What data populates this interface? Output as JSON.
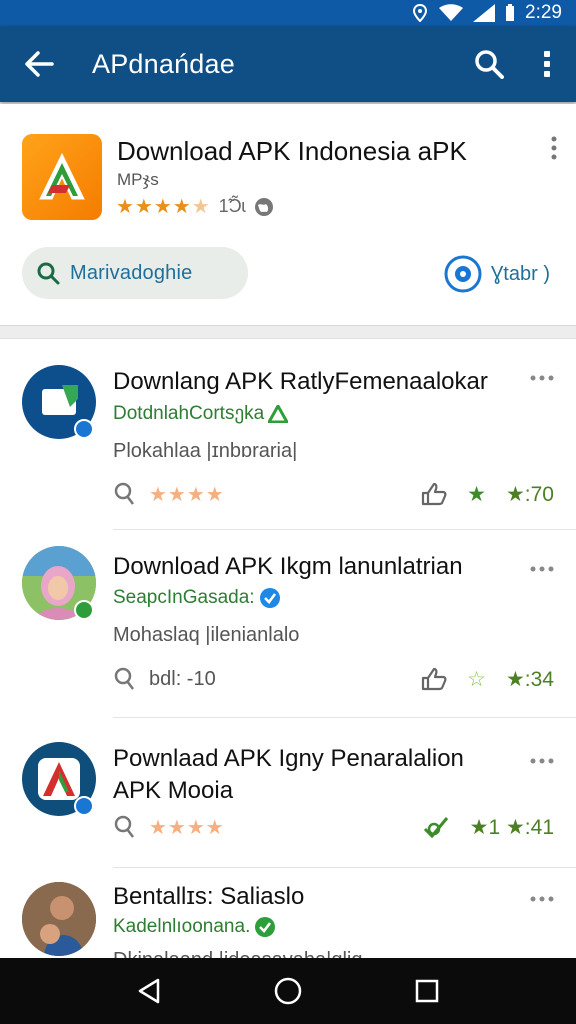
{
  "status_bar": {
    "time": "2:29"
  },
  "app_bar": {
    "title": "APdnańdae"
  },
  "header_card": {
    "title": "Download APK Indonesia aPK",
    "subtitle": "MPჯs",
    "rating_stars": 4,
    "rating_count": "1̃Ɔ̃ɩ",
    "search_pill_label": "Marivadoɡhie",
    "status_label": "Ɣtabr )"
  },
  "items": [
    {
      "title": "Downlang APK RatlyFemenaalokar",
      "developer": "DotdnlahCortsეka",
      "description": "Plokahlaa |ɪnbɒraria|",
      "rating_stars": 4,
      "score_label": "★:70",
      "meta_text": ""
    },
    {
      "title": "Download APK Ikgm lanunlatrian",
      "developer": "SeapcInGasada:",
      "description": "Mohaslaq |ilenianlalo",
      "rating_stars": 0,
      "score_label": "★:34",
      "meta_text": "bdl: -10"
    },
    {
      "title": "Pownlaad APK Igny Penaralalion",
      "title_line2": "APK Mooia",
      "rating_stars": 4,
      "score_label": "★1 ★:41"
    },
    {
      "title": "Bentallɪs: Saliaslo",
      "developer": "Kadelnlıoonana.",
      "description": "Dkinalaand |ideasavaha|ɑliɑ"
    }
  ],
  "colors": {
    "status_bar": "#0e5aa6",
    "app_bar": "#0f4f85",
    "accent_blue": "#1f6f9a",
    "green": "#2e7d32",
    "star_orange": "#e8901a"
  },
  "icons": {
    "back": "arrow-back-icon",
    "search": "search-icon",
    "overflow": "overflow-menu-icon",
    "nav_back": "nav-back-icon",
    "nav_home": "nav-home-icon",
    "nav_recents": "nav-recents-icon"
  }
}
